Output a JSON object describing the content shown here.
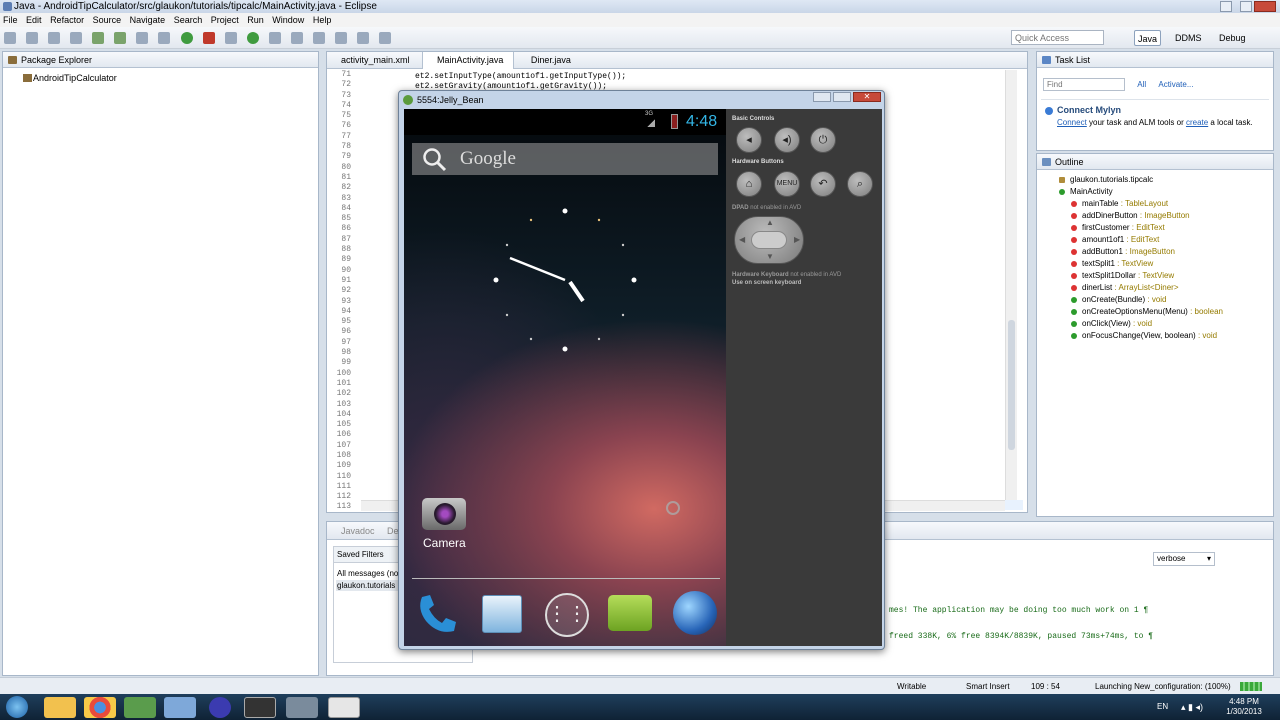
{
  "window": {
    "title": "Java - AndroidTipCalculator/src/glaukon/tutorials/tipcalc/MainActivity.java - Eclipse"
  },
  "menu": [
    "File",
    "Edit",
    "Refactor",
    "Source",
    "Navigate",
    "Search",
    "Project",
    "Run",
    "Window",
    "Help"
  ],
  "toolbar": {
    "quick_access_placeholder": "Quick Access",
    "persp_java": "Java",
    "persp_ddms": "DDMS",
    "persp_debug": "Debug"
  },
  "package_explorer": {
    "title": "Package Explorer",
    "project": "AndroidTipCalculator"
  },
  "editor": {
    "tabs": [
      "activity_main.xml",
      "MainActivity.java",
      "Diner.java"
    ],
    "line_numbers": [
      "71",
      "72",
      "73",
      "74",
      "75",
      "76",
      "77",
      "78",
      "79",
      "80",
      "81",
      "82",
      "83",
      "84",
      "85",
      "86",
      "87",
      "88",
      "89",
      "90",
      "91",
      "92",
      "93",
      "94",
      "95",
      "96",
      "97",
      "98",
      "99",
      "100",
      "101",
      "102",
      "103",
      "104",
      "105",
      "106",
      "107",
      "108",
      "109",
      "110",
      "111",
      "112",
      "113"
    ],
    "line1": "et2.setInputType(amount1of1.getInputType());",
    "line2": "et2.setGravity(amount1of1.getGravity());"
  },
  "task_list": {
    "title": "Task List",
    "find_placeholder": "Find",
    "all": "All",
    "activate": "Activate..."
  },
  "mylyn": {
    "title": "Connect Mylyn",
    "connect": "Connect",
    "text1": " your task and ALM tools or ",
    "create": "create",
    "text2": " a local task."
  },
  "outline": {
    "title": "Outline",
    "package": "glaukon.tutorials.tipcalc",
    "class": "MainActivity",
    "fields": [
      {
        "name": "mainTable",
        "type": " : TableLayout"
      },
      {
        "name": "addDinerButton",
        "type": " : ImageButton"
      },
      {
        "name": "firstCustomer",
        "type": " : EditText"
      },
      {
        "name": "amount1of1",
        "type": " : EditText"
      },
      {
        "name": "addButton1",
        "type": " : ImageButton"
      },
      {
        "name": "textSplit1",
        "type": " : TextView"
      },
      {
        "name": "textSplit1Dollar",
        "type": " : TextView"
      },
      {
        "name": "dinerList",
        "type": " : ArrayList<Diner>"
      }
    ],
    "methods": [
      {
        "name": "onCreate(Bundle)",
        "type": " : void"
      },
      {
        "name": "onCreateOptionsMenu(Menu)",
        "type": " : boolean"
      },
      {
        "name": "onClick(View)",
        "type": " : void"
      },
      {
        "name": "onFocusChange(View, boolean)",
        "type": " : void"
      }
    ]
  },
  "bottom": {
    "tabs": [
      "Javadoc",
      "De"
    ],
    "saved_filters": "Saved Filters",
    "all_messages": "All messages (no",
    "filter_item": "glaukon.tutorials",
    "verbose": "verbose",
    "log1": "mes!  The application may be doing too much work on 1 ¶",
    "log2": "freed 338K, 6% free 8394K/8839K, paused 73ms+74ms, to ¶"
  },
  "status": {
    "writable": "Writable",
    "insert": "Smart Insert",
    "position": "109 : 54",
    "launching": "Launching New_configuration: (100%)"
  },
  "emulator": {
    "title": "5554:Jelly_Bean",
    "network": "3G",
    "time": "4:48",
    "search_label": "Google",
    "app_label": "Camera",
    "basic_controls": "Basic Controls",
    "hardware_buttons": "Hardware Buttons",
    "menu_label": "MENU",
    "dpad_title": "DPAD",
    "dpad_note": " not enabled in AVD",
    "kbd_title": "Hardware Keyboard",
    "kbd_note": " not enabled in AVD",
    "kbd_use": "Use on screen keyboard"
  },
  "taskbar": {
    "lang": "EN",
    "clock_time": "4:48 PM",
    "clock_date": "1/30/2013"
  },
  "colors": {
    "accent_blue": "#33b5e5",
    "link_blue": "#1f5fb8"
  }
}
